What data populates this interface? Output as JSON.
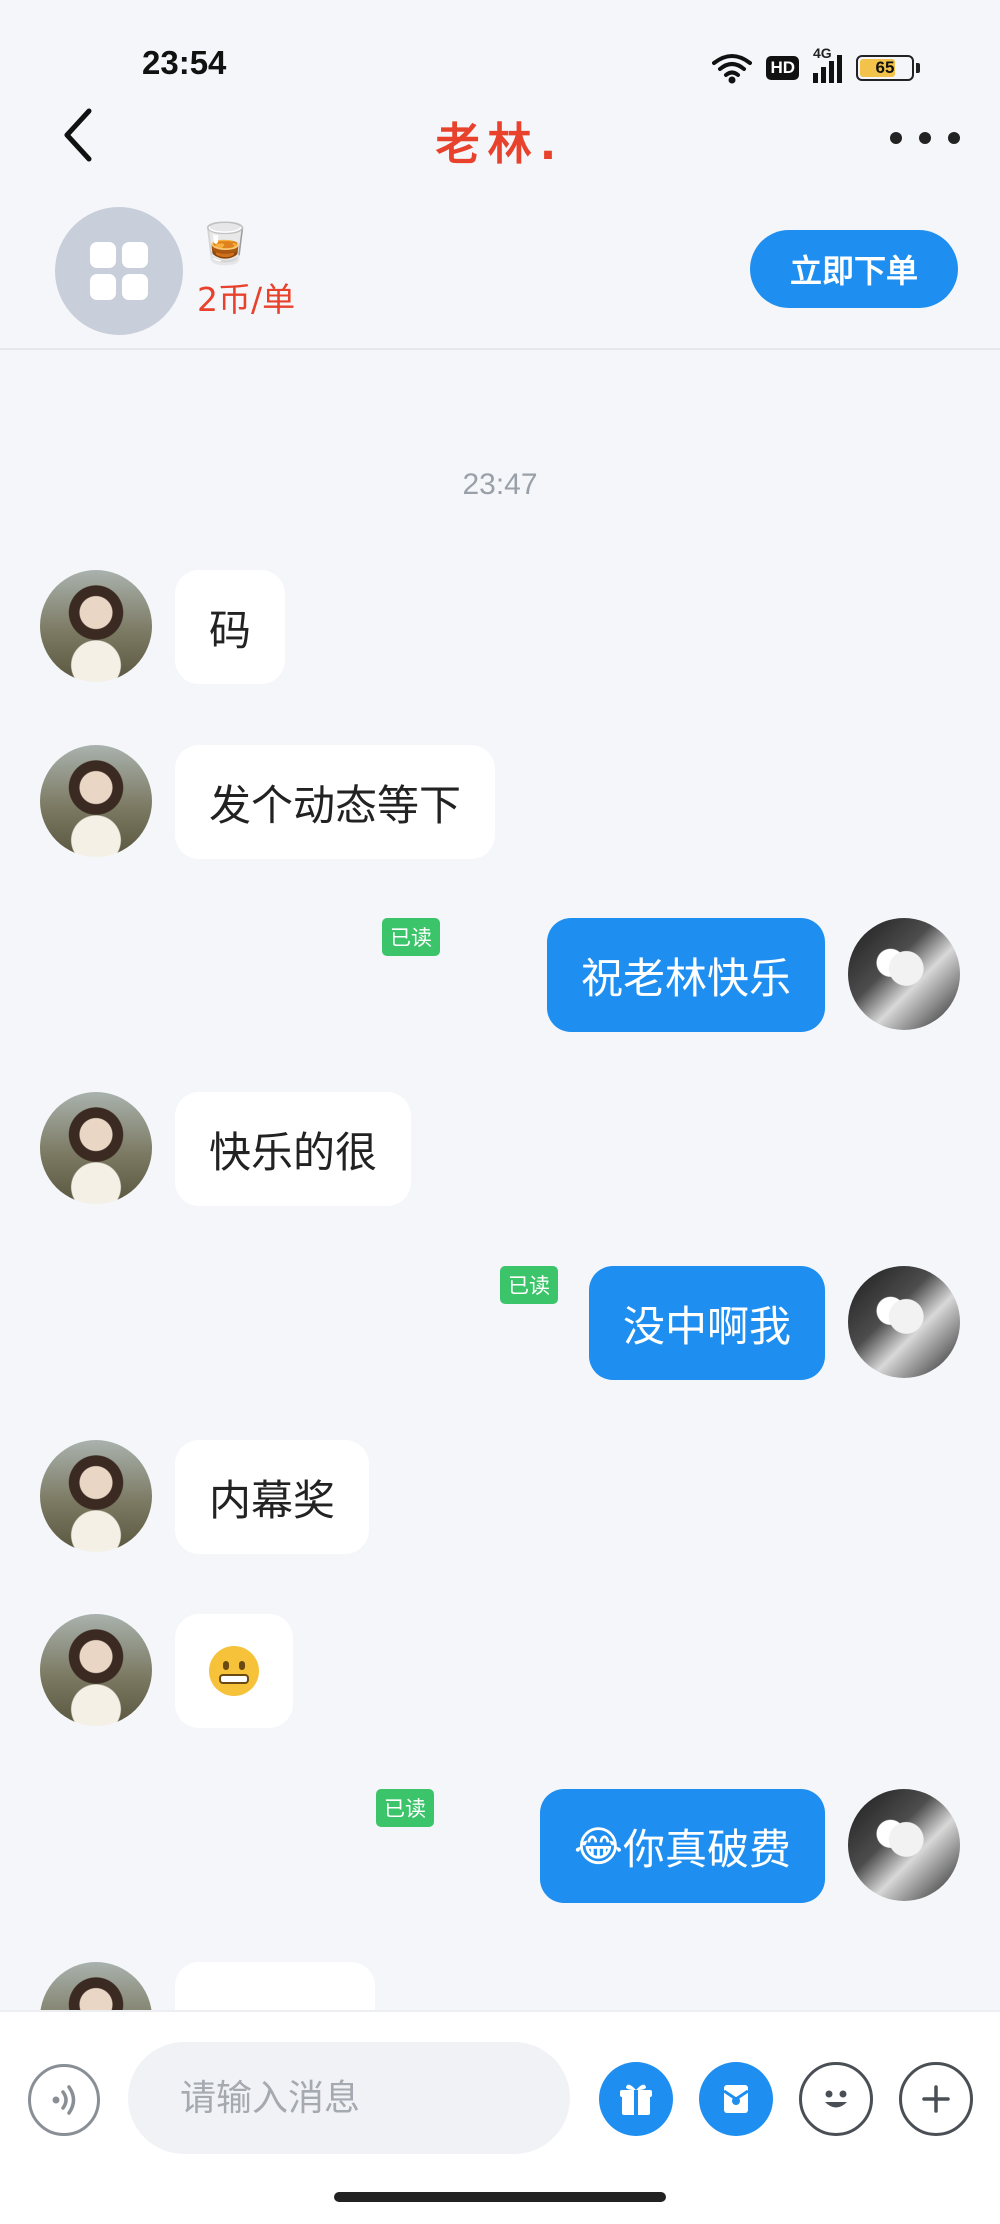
{
  "status": {
    "time": "23:54",
    "hd_label": "HD",
    "network_label": "4G",
    "battery_level": "65"
  },
  "header": {
    "title": "老林."
  },
  "service": {
    "emoji": "🥃",
    "price": "2币/单",
    "order_button": "立即下单"
  },
  "chat": {
    "timestamp": "23:47",
    "read_label": "已读",
    "messages": [
      {
        "from": "other",
        "text": "码"
      },
      {
        "from": "other",
        "text": "发个动态等下"
      },
      {
        "from": "me",
        "text": "祝老林快乐",
        "status": "已读"
      },
      {
        "from": "other",
        "text": "快乐的很"
      },
      {
        "from": "me",
        "text": "没中啊我",
        "status": "已读"
      },
      {
        "from": "other",
        "text": "内幕奖"
      },
      {
        "from": "other",
        "emoji": "grimacing-face"
      },
      {
        "from": "me",
        "emoji": "😂",
        "text": "你真破费",
        "status": "已读"
      }
    ]
  },
  "input": {
    "placeholder": "请输入消息"
  },
  "colors": {
    "accent": "#1e8ff0",
    "title_red": "#e8412c",
    "read_green": "#3cc46a",
    "background": "#f4f6fa"
  },
  "icons": [
    "back-arrow-icon",
    "more-icon",
    "voice-icon",
    "gift-icon",
    "card-icon",
    "emoji-icon",
    "plus-icon"
  ]
}
